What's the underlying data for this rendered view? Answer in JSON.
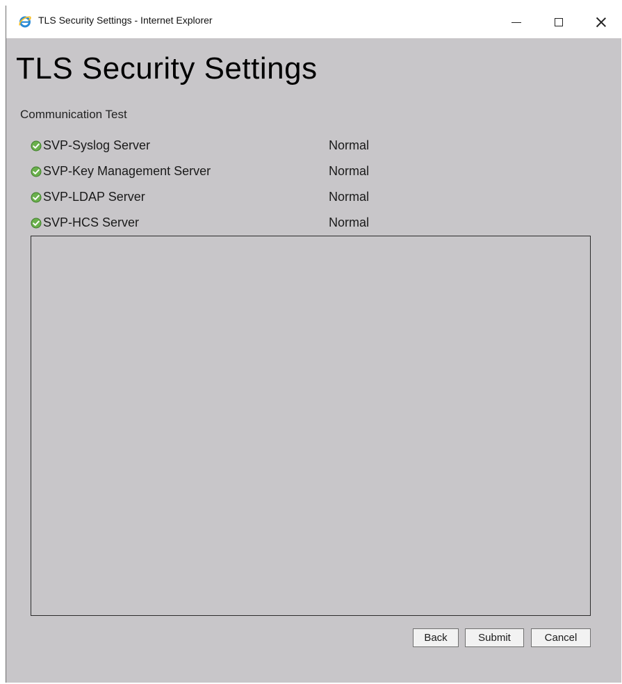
{
  "window": {
    "title": "TLS Security Settings - Internet Explorer",
    "app_icon": "internet-explorer-icon",
    "controls": [
      "minimize-icon",
      "maximize-icon",
      "close-icon"
    ]
  },
  "page": {
    "title": "TLS Security Settings",
    "section_label": "Communication Test"
  },
  "tests": [
    {
      "name": "SVP-Syslog Server",
      "status": "Normal",
      "icon": "check-circle-icon"
    },
    {
      "name": "SVP-Key Management Server",
      "status": "Normal",
      "icon": "check-circle-icon"
    },
    {
      "name": "SVP-LDAP Server",
      "status": "Normal",
      "icon": "check-circle-icon"
    },
    {
      "name": "SVP-HCS Server",
      "status": "Normal",
      "icon": "check-circle-icon"
    }
  ],
  "buttons": {
    "back": "Back",
    "submit": "Submit",
    "cancel": "Cancel"
  },
  "colors": {
    "background": "#c8c6c9",
    "status_ok": "#6ab04c"
  }
}
